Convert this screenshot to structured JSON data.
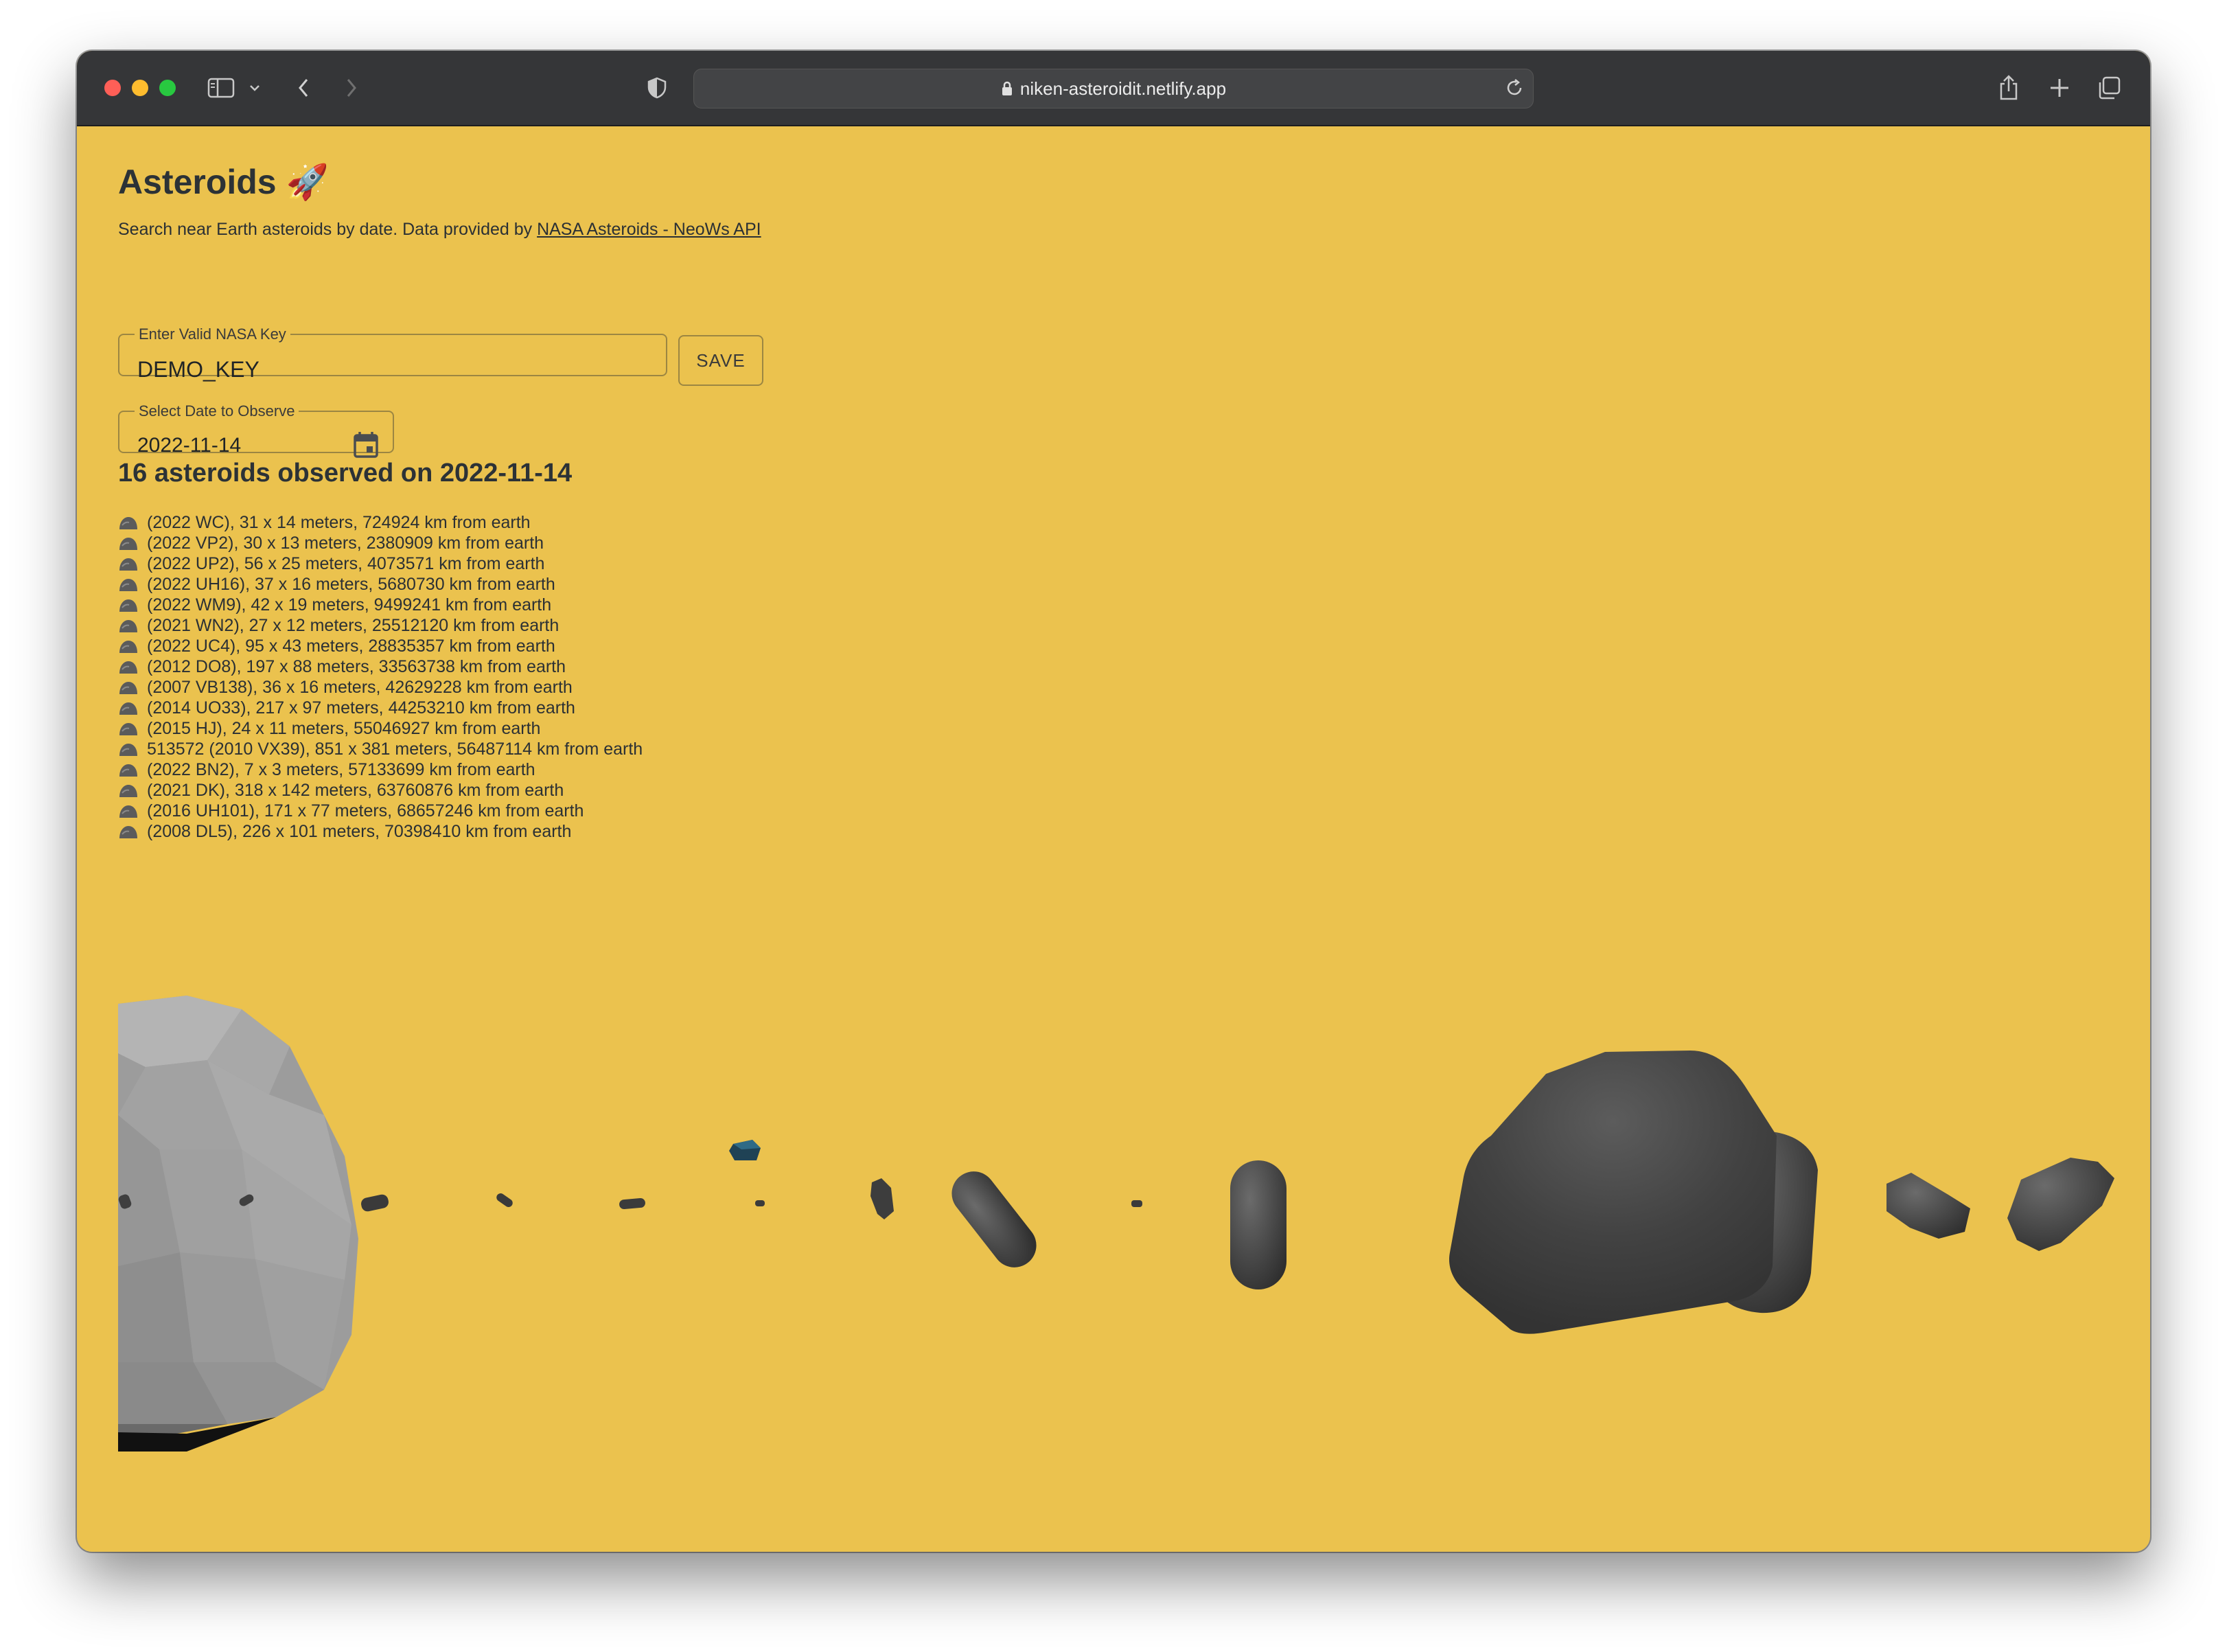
{
  "browser": {
    "url": "niken-asteroidit.netlify.app"
  },
  "page": {
    "title": "Asteroids 🚀",
    "subtitle_prefix": "Search near Earth asteroids by date. Data provided by ",
    "subtitle_link": "NASA Asteroids - NeoWs API",
    "key_field": {
      "label": "Enter Valid NASA Key",
      "value": "DEMO_KEY"
    },
    "save_label": "SAVE",
    "date_field": {
      "label": "Select Date to Observe",
      "value": "2022-11-14"
    },
    "results_heading": "16 asteroids observed on 2022-11-14",
    "asteroids": [
      "(2022 WC), 31 x 14 meters, 724924 km from earth",
      "(2022 VP2), 30 x 13 meters, 2380909 km from earth",
      "(2022 UP2), 56 x 25 meters, 4073571 km from earth",
      "(2022 UH16), 37 x 16 meters, 5680730 km from earth",
      "(2022 WM9), 42 x 19 meters, 9499241 km from earth",
      "(2021 WN2), 27 x 12 meters, 25512120 km from earth",
      "(2022 UC4), 95 x 43 meters, 28835357 km from earth",
      "(2012 DO8), 197 x 88 meters, 33563738 km from earth",
      "(2007 VB138), 36 x 16 meters, 42629228 km from earth",
      "(2014 UO33), 217 x 97 meters, 44253210 km from earth",
      "(2015 HJ), 24 x 11 meters, 55046927 km from earth",
      "513572 (2010 VX39), 851 x 381 meters, 56487114 km from earth",
      "(2022 BN2), 7 x 3 meters, 57133699 km from earth",
      "(2021 DK), 318 x 142 meters, 63760876 km from earth",
      "(2016 UH101), 171 x 77 meters, 68657246 km from earth",
      "(2008 DL5), 226 x 101 meters, 70398410 km from earth"
    ]
  },
  "colors": {
    "background": "#EBC24E",
    "text": "#2c3236",
    "asteroid": "#4a4a4a",
    "earth": "#a9a9a9"
  },
  "icons": {
    "list_bullet": "rock-icon",
    "date_picker": "calendar-icon"
  }
}
